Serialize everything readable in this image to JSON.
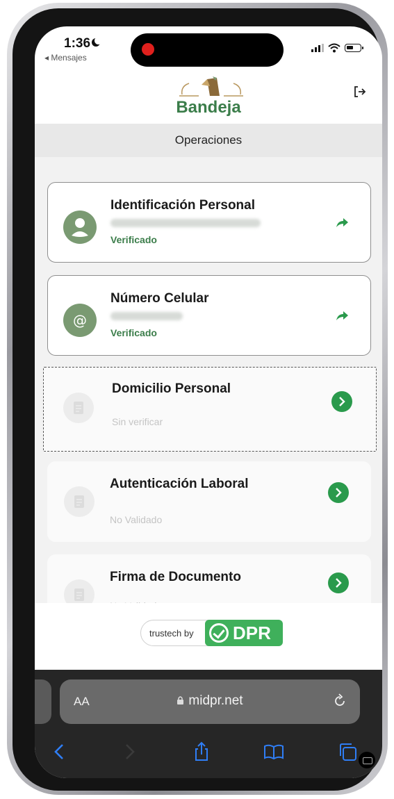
{
  "status_bar": {
    "time": "1:36",
    "back_label": "◂ Mensajes"
  },
  "header": {
    "title": "Bandeja"
  },
  "section": {
    "title": "Operaciones"
  },
  "cards": [
    {
      "title": "Identificación Personal",
      "status": "Verificado",
      "state": "verified",
      "icon": "user-icon"
    },
    {
      "title": "Número Celular",
      "status": "Verificado",
      "state": "verified",
      "icon": "at-icon"
    },
    {
      "title": "Domicilio Personal",
      "status": "Sin verificar",
      "state": "pending",
      "icon": "document-icon"
    },
    {
      "title": "Autenticación Laboral",
      "status": "No Validado",
      "state": "pending",
      "icon": "document-icon"
    },
    {
      "title": "Firma de Documento",
      "status": "No Validado",
      "state": "pending",
      "icon": "document-icon"
    }
  ],
  "footer": {
    "trust_text": "trustech by",
    "trust_brand": "DPR"
  },
  "browser": {
    "text_size_label": "AA",
    "url": "midpr.net"
  },
  "colors": {
    "brand_green": "#3b7d4a",
    "avatar_green": "#7a9a72",
    "action_green": "#2a9a4c",
    "trust_green": "#3fb05b",
    "browser_chrome": "#262626",
    "ios_blue": "#2f7ef6"
  }
}
